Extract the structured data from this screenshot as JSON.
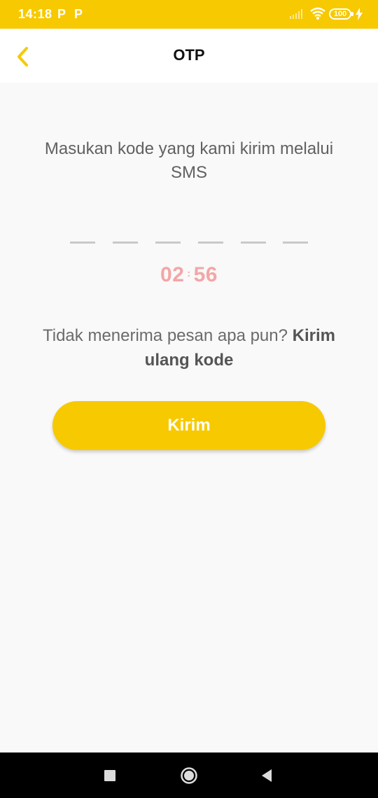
{
  "status_bar": {
    "time": "14:18",
    "notif_1": "P",
    "notif_2": "P",
    "battery": "100",
    "icons": [
      "signal-icon",
      "wifi-icon",
      "battery-icon",
      "charging-bolt-icon"
    ]
  },
  "header": {
    "title": "OTP",
    "back_icon": "chevron-left-icon"
  },
  "main": {
    "instruction": "Masukan kode yang kami kirim melalui SMS",
    "otp_slot_count": 6,
    "timer_minutes": "02",
    "timer_separator": ":",
    "timer_seconds": "56",
    "resend_prefix": "Tidak menerima pesan apa pun? ",
    "resend_link": "Kirim ulang kode",
    "submit_label": "Kirim"
  },
  "nav_bar": {
    "icons": [
      "recents-square-icon",
      "home-circle-icon",
      "back-triangle-icon"
    ]
  },
  "colors": {
    "accent": "#f7c900",
    "timer": "#f3a6a6",
    "background": "#f9f9f9"
  }
}
